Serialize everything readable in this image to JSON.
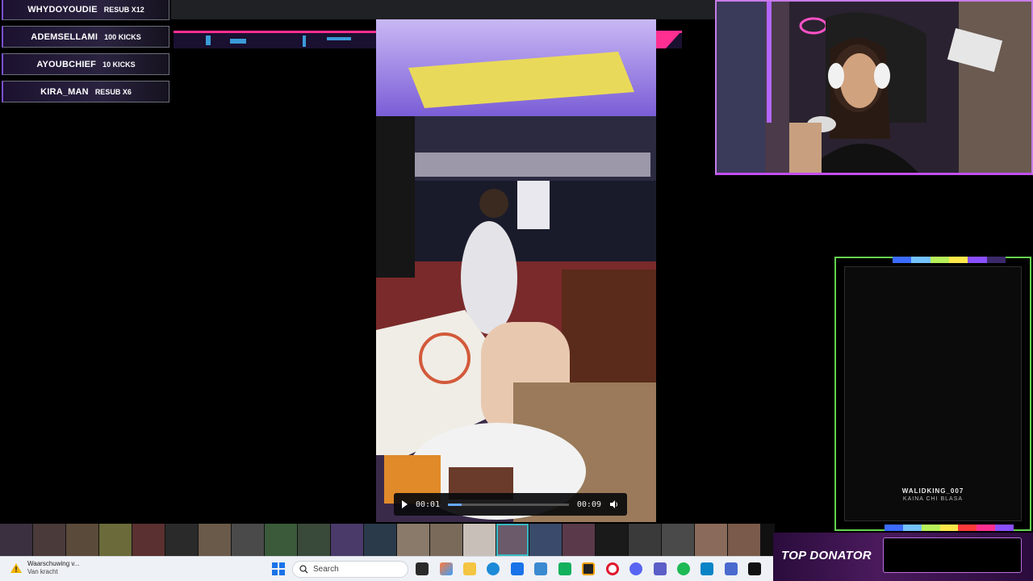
{
  "alerts": [
    {
      "user": "WHYDOYOUDIE",
      "action": "RESUB X12"
    },
    {
      "user": "ADEMSELLAMI",
      "action": "100 KICKS"
    },
    {
      "user": "AYOUBCHIEF",
      "action": "10 KICKS"
    },
    {
      "user": "KIRA_MAN",
      "action": "RESUB X6"
    }
  ],
  "video": {
    "current_time": "00:01",
    "duration": "00:09",
    "progress": 0.11
  },
  "donation": {
    "name": "WALIDKING_007",
    "message": "KAINA CHI BLASA"
  },
  "top_donator": {
    "label": "TOP DONATOR"
  },
  "taskbar": {
    "warning_title": "Waarschuwing v...",
    "warning_sub": "Van kracht",
    "search_placeholder": "Search"
  },
  "colors": {
    "accent_purple": "#c24ff0",
    "accent_green": "#64d34f",
    "accent_pink": "#ff2f92",
    "accent_cyan": "#37b9c4"
  }
}
